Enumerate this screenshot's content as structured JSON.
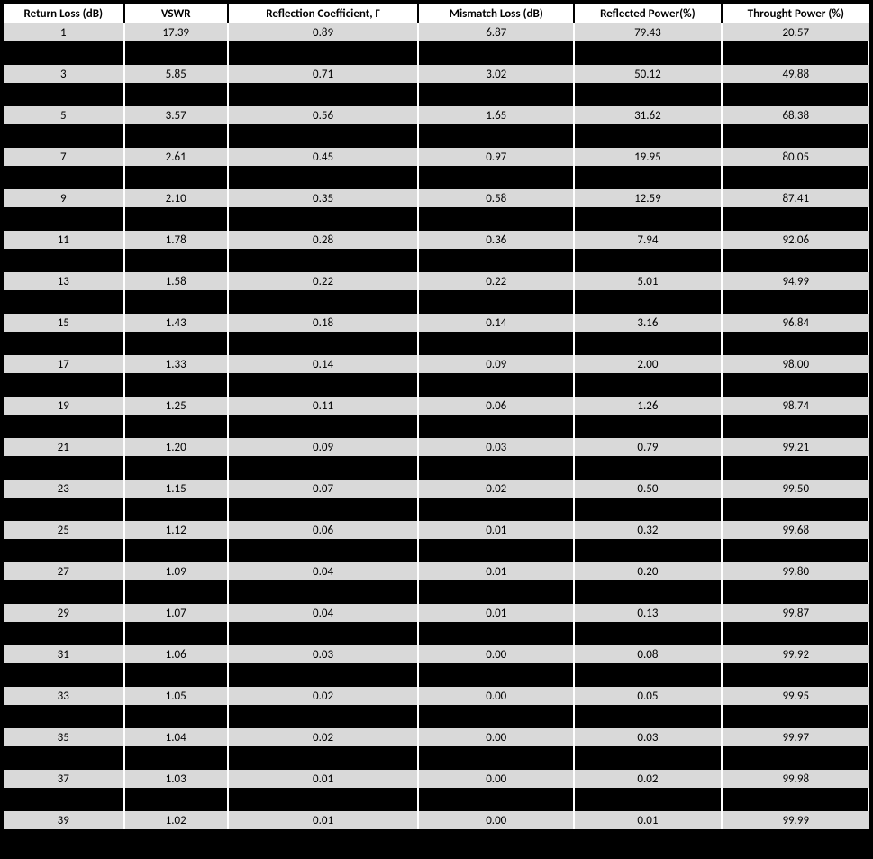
{
  "chart_data": {
    "type": "table",
    "title": "",
    "columns": [
      "Return Loss (dB)",
      "VSWR",
      "Reflection Coefficient, Γ",
      "Mismatch Loss (dB)",
      "Reflected Power(%)",
      "Throught Power (%)"
    ],
    "rows": [
      [
        "1",
        "17.39",
        "0.89",
        "6.87",
        "79.43",
        "20.57"
      ],
      [
        "3",
        "5.85",
        "0.71",
        "3.02",
        "50.12",
        "49.88"
      ],
      [
        "5",
        "3.57",
        "0.56",
        "1.65",
        "31.62",
        "68.38"
      ],
      [
        "7",
        "2.61",
        "0.45",
        "0.97",
        "19.95",
        "80.05"
      ],
      [
        "9",
        "2.10",
        "0.35",
        "0.58",
        "12.59",
        "87.41"
      ],
      [
        "11",
        "1.78",
        "0.28",
        "0.36",
        "7.94",
        "92.06"
      ],
      [
        "13",
        "1.58",
        "0.22",
        "0.22",
        "5.01",
        "94.99"
      ],
      [
        "15",
        "1.43",
        "0.18",
        "0.14",
        "3.16",
        "96.84"
      ],
      [
        "17",
        "1.33",
        "0.14",
        "0.09",
        "2.00",
        "98.00"
      ],
      [
        "19",
        "1.25",
        "0.11",
        "0.06",
        "1.26",
        "98.74"
      ],
      [
        "21",
        "1.20",
        "0.09",
        "0.03",
        "0.79",
        "99.21"
      ],
      [
        "23",
        "1.15",
        "0.07",
        "0.02",
        "0.50",
        "99.50"
      ],
      [
        "25",
        "1.12",
        "0.06",
        "0.01",
        "0.32",
        "99.68"
      ],
      [
        "27",
        "1.09",
        "0.04",
        "0.01",
        "0.20",
        "99.80"
      ],
      [
        "29",
        "1.07",
        "0.04",
        "0.01",
        "0.13",
        "99.87"
      ],
      [
        "31",
        "1.06",
        "0.03",
        "0.00",
        "0.08",
        "99.92"
      ],
      [
        "33",
        "1.05",
        "0.02",
        "0.00",
        "0.05",
        "99.95"
      ],
      [
        "35",
        "1.04",
        "0.02",
        "0.00",
        "0.03",
        "99.97"
      ],
      [
        "37",
        "1.03",
        "0.01",
        "0.00",
        "0.02",
        "99.98"
      ],
      [
        "39",
        "1.02",
        "0.01",
        "0.00",
        "0.01",
        "99.99"
      ]
    ]
  }
}
